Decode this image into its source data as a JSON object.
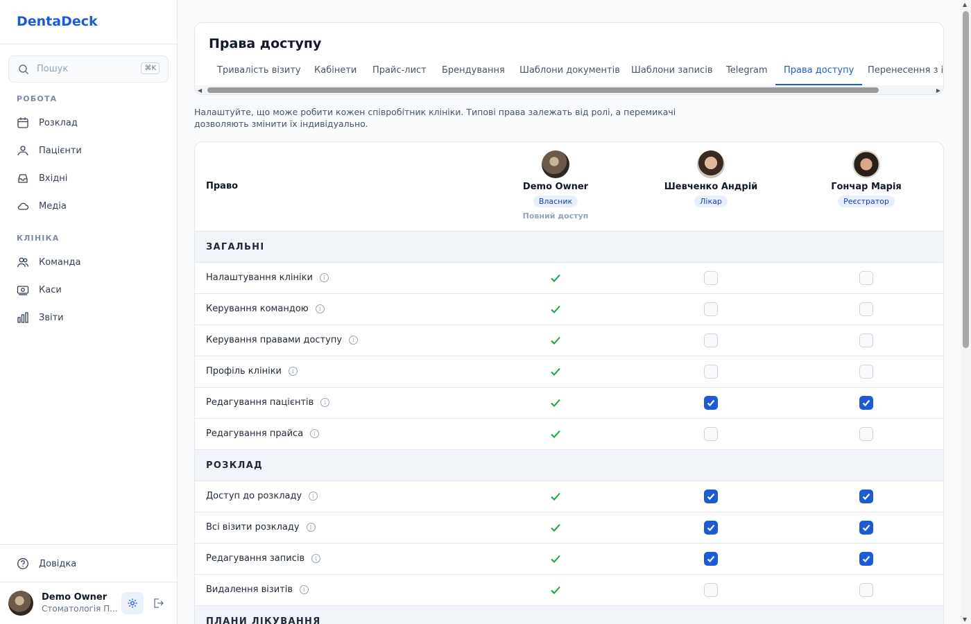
{
  "app": {
    "logo": "DentaDeck"
  },
  "search": {
    "placeholder": "Пошук",
    "shortcut": "⌘K"
  },
  "nav": {
    "work_title": "РОБОТА",
    "work_items": [
      {
        "label": "Розклад",
        "icon": "calendar-icon"
      },
      {
        "label": "Пацієнти",
        "icon": "users-icon"
      },
      {
        "label": "Вхідні",
        "icon": "inbox-icon"
      },
      {
        "label": "Медіа",
        "icon": "cloud-icon"
      }
    ],
    "clinic_title": "КЛІНІКА",
    "clinic_items": [
      {
        "label": "Команда",
        "icon": "team-icon"
      },
      {
        "label": "Каси",
        "icon": "cash-register-icon"
      },
      {
        "label": "Звіти",
        "icon": "bar-chart-icon"
      }
    ],
    "help": "Довідка"
  },
  "user": {
    "name": "Demo Owner",
    "subtitle": "Стоматологія П..."
  },
  "page": {
    "title": "Права доступу",
    "description": "Налаштуйте, що може робити кожен співробітник клініки. Типові права залежать від ролі, а перемикачі дозволяють змінити їх індивідуально.",
    "tabs": [
      "Тривалість візиту",
      "Кабінети",
      "Прайс-лист",
      "Брендування",
      "Шаблони документів",
      "Шаблони записів",
      "Telegram",
      "Права доступу",
      "Перенесення з ін"
    ],
    "active_tab": "Права доступу"
  },
  "table": {
    "column_header": "Право",
    "members": [
      {
        "name": "Demo Owner",
        "role": "Власник",
        "note": "Повний доступ"
      },
      {
        "name": "Шевченко Андрій",
        "role": "Лікар",
        "note": ""
      },
      {
        "name": "Гончар Марія",
        "role": "Реєстратор",
        "note": ""
      }
    ],
    "sections": [
      {
        "title": "ЗАГАЛЬНІ",
        "rows": [
          {
            "label": "Налаштування клініки",
            "values": [
              true,
              false,
              false
            ]
          },
          {
            "label": "Керування командою",
            "values": [
              true,
              false,
              false
            ]
          },
          {
            "label": "Керування правами доступу",
            "values": [
              true,
              false,
              false
            ]
          },
          {
            "label": "Профіль клініки",
            "values": [
              true,
              false,
              false
            ]
          },
          {
            "label": "Редагування пацієнтів",
            "values": [
              true,
              true,
              true
            ]
          },
          {
            "label": "Редагування прайса",
            "values": [
              true,
              false,
              false
            ]
          }
        ]
      },
      {
        "title": "РОЗКЛАД",
        "rows": [
          {
            "label": "Доступ до розкладу",
            "values": [
              true,
              true,
              true
            ]
          },
          {
            "label": "Всі візити розкладу",
            "values": [
              true,
              true,
              true
            ]
          },
          {
            "label": "Редагування записів",
            "values": [
              true,
              true,
              true
            ]
          },
          {
            "label": "Видалення візитів",
            "values": [
              true,
              false,
              false
            ]
          }
        ]
      },
      {
        "title": "ПЛАНИ ЛІКУВАННЯ",
        "rows": []
      }
    ]
  },
  "colors": {
    "accent": "#1d5bd6",
    "check_green": "#16a34a"
  }
}
